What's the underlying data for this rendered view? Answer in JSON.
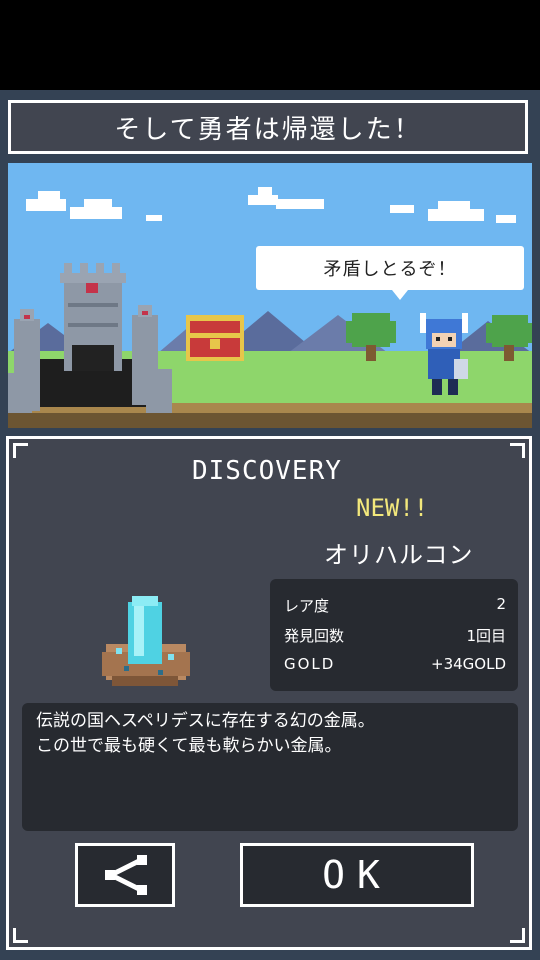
{
  "header": {
    "title": "そして勇者は帰還した！"
  },
  "scene": {
    "speech": "矛盾しとるぞ！",
    "colors": {
      "sky": "#6fb7f1",
      "grass": "#8ed66b",
      "castle": "#8e98a6"
    }
  },
  "discovery": {
    "heading": "DISCOVERY",
    "badge": "NEW!!",
    "item_name": "オリハルコン",
    "stats": [
      {
        "label": "レア度",
        "value": "2"
      },
      {
        "label": "発見回数",
        "value": "1回目"
      },
      {
        "label": "GOLD",
        "value": "+34GOLD"
      }
    ],
    "description": [
      "伝説の国ヘスペリデスに存在する幻の金属。",
      "この世で最も硬くて最も軟らかい金属。"
    ]
  },
  "buttons": {
    "back_icon": "share-back-icon",
    "ok_label": "OK"
  }
}
